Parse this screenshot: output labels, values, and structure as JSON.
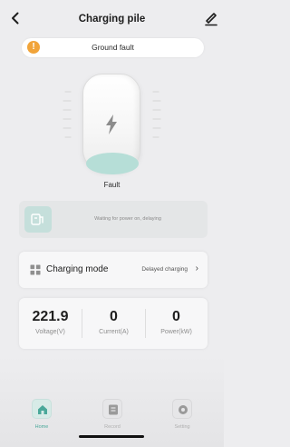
{
  "header": {
    "title": "Charging pile",
    "back_icon": "chevron-left-icon",
    "edit_icon": "pencil-icon"
  },
  "alert": {
    "icon": "warning-icon",
    "text": "Ground fault",
    "color": "#f1a43a"
  },
  "pile": {
    "status": "Fault",
    "accent_color": "#b6ded7"
  },
  "waiting": {
    "icon": "plug-icon",
    "text": "Waiting for power on, delaying"
  },
  "mode": {
    "icon": "grid-icon",
    "label": "Charging mode",
    "value": "Delayed charging",
    "chevron": "›"
  },
  "stats": [
    {
      "value": "221.9",
      "label": "Voltage(V)"
    },
    {
      "value": "0",
      "label": "Current(A)"
    },
    {
      "value": "0",
      "label": "Power(kW)"
    }
  ],
  "tabs": [
    {
      "label": "Home",
      "icon": "home-icon",
      "active": true
    },
    {
      "label": "Record",
      "icon": "record-icon",
      "active": false
    },
    {
      "label": "Setting",
      "icon": "gear-icon",
      "active": false
    }
  ]
}
